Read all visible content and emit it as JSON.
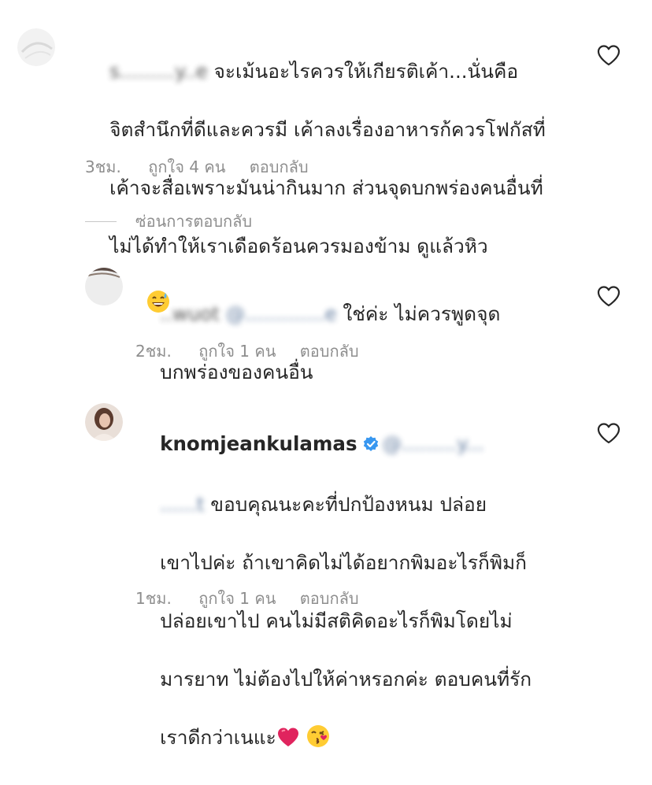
{
  "comments": [
    {
      "username_blurred": "s.........y..e",
      "text_line1": " จะเม้นอะไรควรให้เกียรติเค้า...นั่นคือ",
      "text_line2": "จิตสำนึกที่ดีและควรมี เค้าลงเรื่องอาหารก้ควรโฟกัสที่",
      "text_line3": "เค้าจะสื่อเพราะมันน่ากินมาก ส่วนจุดบกพร่องคนอื่นที่",
      "text_line4": "ไม่ได้ทำให้เราเดือดร้อนควรมองข้าม ดูแล้วหิว",
      "emoji": "grinning-sweat-emoji",
      "time": "3ชม.",
      "likes": "ถูกใจ 4 คน",
      "reply": "ตอบกลับ"
    },
    {
      "username_blurred": "..wuot",
      "mention_blurred": "@.............e",
      "text_line1": " ใช่ค่ะ ไม่ควรพูดจุด",
      "text_line2": "บกพร่องของคนอื่น",
      "time": "2ชม.",
      "likes": "ถูกใจ 1 คน",
      "reply": "ตอบกลับ"
    },
    {
      "username": "knomjeankulamas",
      "mention_blurred": "@.........y...",
      "text_prefix_blurred": "......t",
      "text_line1": " ขอบคุณนะคะที่ปกป้องหนม ปล่อย",
      "text_line2": "เขาไปค่ะ ถ้าเขาคิดไม่ได้อยากพิมอะไรก็พิมก็",
      "text_line3": "ปล่อยเขาไป คนไม่มีสติคิดอะไรก็พิมโดยไม่",
      "text_line4": "มารยาท ไม่ต้องไปให้ค่าหรอกค่ะ ตอบคนที่รัก",
      "text_line5": "เราดีกว่าเนแะ",
      "emojis": [
        "red-heart-emoji",
        "kiss-emoji"
      ],
      "time": "1ชม.",
      "likes": "ถูกใจ 1 คน",
      "reply": "ตอบกลับ"
    }
  ],
  "hide_replies": "ซ่อนการตอบกลับ",
  "colors": {
    "text": "#262626",
    "meta": "#8e8e8e",
    "verified": "#3897f0",
    "heart_emoji": "#e0245e"
  }
}
